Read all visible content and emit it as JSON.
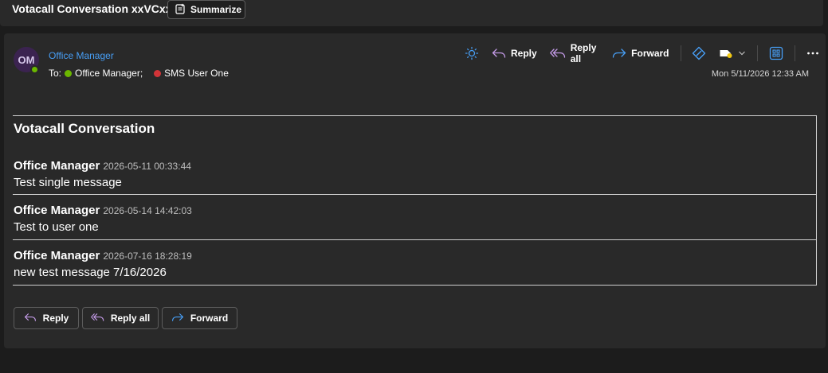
{
  "header": {
    "subject": "Votacall Conversation xxVCxx",
    "summarize_label": "Summarize"
  },
  "email": {
    "avatar_initials": "OM",
    "sender": "Office Manager",
    "to_label": "To:",
    "recipients": [
      "Office Manager;",
      "SMS User One"
    ],
    "date": "Mon 5/11/2026 12:33 AM"
  },
  "toolbar": {
    "reply": "Reply",
    "reply_all": "Reply all",
    "forward": "Forward"
  },
  "conversation": {
    "title": "Votacall Conversation",
    "messages": [
      {
        "author": "Office Manager",
        "time": "2026-05-11 00:33:44",
        "text": "Test single message"
      },
      {
        "author": "Office Manager",
        "time": "2026-05-14 14:42:03",
        "text": "Test to user one"
      },
      {
        "author": "Office Manager",
        "time": "2026-07-16 18:28:19",
        "text": "new test message 7/16/2026"
      }
    ]
  },
  "footer": {
    "reply": "Reply",
    "reply_all": "Reply all",
    "forward": "Forward"
  },
  "colors": {
    "accent_blue": "#479ef5",
    "reply_all_purple": "#c39ae6",
    "presence_green": "#6bb700",
    "presence_busy": "#d13438"
  }
}
